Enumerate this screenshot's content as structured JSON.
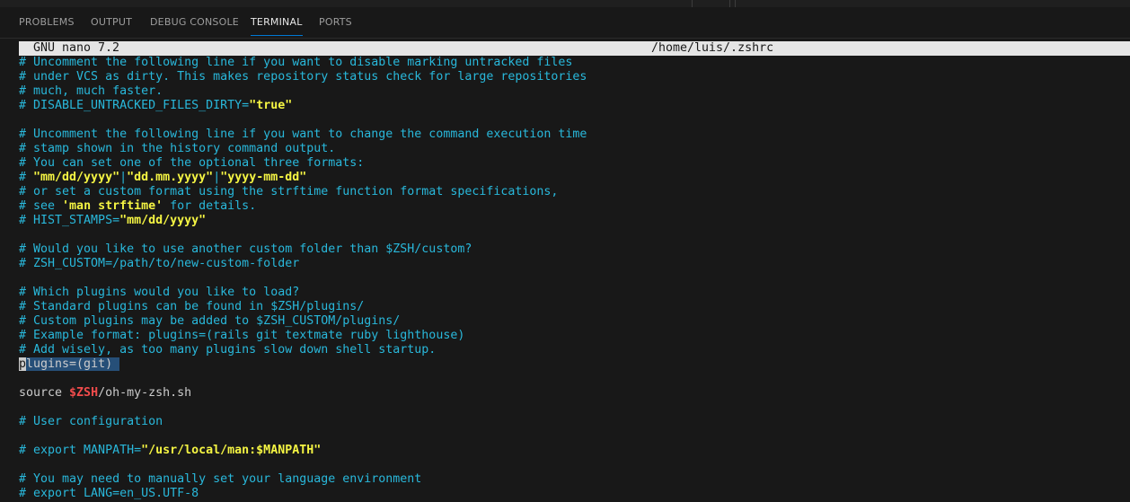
{
  "panel": {
    "tabs": [
      {
        "label": "PROBLEMS"
      },
      {
        "label": "OUTPUT"
      },
      {
        "label": "DEBUG CONSOLE"
      },
      {
        "label": "TERMINAL"
      },
      {
        "label": "PORTS"
      }
    ],
    "active_tab": "TERMINAL"
  },
  "nano": {
    "program": "GNU nano 7.2",
    "file_path": "/home/luis/.zshrc"
  },
  "editor": {
    "lines": [
      {
        "segments": [
          {
            "t": "# Uncomment the following line if you want to disable marking untracked files",
            "k": "c"
          }
        ]
      },
      {
        "segments": [
          {
            "t": "# under VCS as dirty. This makes repository status check for large repositories",
            "k": "c"
          }
        ]
      },
      {
        "segments": [
          {
            "t": "# much, much faster.",
            "k": "c"
          }
        ]
      },
      {
        "segments": [
          {
            "t": "# DISABLE_UNTRACKED_FILES_DIRTY=",
            "k": "c"
          },
          {
            "t": "\"true\"",
            "k": "y"
          }
        ]
      },
      {
        "segments": []
      },
      {
        "segments": [
          {
            "t": "# Uncomment the following line if you want to change the command execution time",
            "k": "c"
          }
        ]
      },
      {
        "segments": [
          {
            "t": "# stamp shown in the history command output.",
            "k": "c"
          }
        ]
      },
      {
        "segments": [
          {
            "t": "# You can set one of the optional three formats:",
            "k": "c"
          }
        ]
      },
      {
        "segments": [
          {
            "t": "# ",
            "k": "c"
          },
          {
            "t": "\"mm/dd/yyyy\"",
            "k": "y"
          },
          {
            "t": "|",
            "k": "c"
          },
          {
            "t": "\"dd.mm.yyyy\"",
            "k": "y"
          },
          {
            "t": "|",
            "k": "c"
          },
          {
            "t": "\"yyyy-mm-dd\"",
            "k": "y"
          }
        ]
      },
      {
        "segments": [
          {
            "t": "# or set a custom format using the strftime function format specifications,",
            "k": "c"
          }
        ]
      },
      {
        "segments": [
          {
            "t": "# see ",
            "k": "c"
          },
          {
            "t": "'man strftime'",
            "k": "y"
          },
          {
            "t": " for details.",
            "k": "c"
          }
        ]
      },
      {
        "segments": [
          {
            "t": "# HIST_STAMPS=",
            "k": "c"
          },
          {
            "t": "\"mm/dd/yyyy\"",
            "k": "y"
          }
        ]
      },
      {
        "segments": []
      },
      {
        "segments": [
          {
            "t": "# Would you like to use another custom folder than $ZSH/custom?",
            "k": "c"
          }
        ]
      },
      {
        "segments": [
          {
            "t": "# ZSH_CUSTOM=/path/to/new-custom-folder",
            "k": "c"
          }
        ]
      },
      {
        "segments": []
      },
      {
        "segments": [
          {
            "t": "# Which plugins would you like to load?",
            "k": "c"
          }
        ]
      },
      {
        "segments": [
          {
            "t": "# Standard plugins can be found in $ZSH/plugins/",
            "k": "c"
          }
        ]
      },
      {
        "segments": [
          {
            "t": "# Custom plugins may be added to $ZSH_CUSTOM/plugins/",
            "k": "c"
          }
        ]
      },
      {
        "segments": [
          {
            "t": "# Example format: plugins=(rails git textmate ruby lighthouse)",
            "k": "c"
          }
        ]
      },
      {
        "segments": [
          {
            "t": "# Add wisely, as too many plugins slow down shell startup.",
            "k": "c"
          }
        ]
      },
      {
        "segments": [
          {
            "t": "p",
            "k": "cursor"
          },
          {
            "t": "lugins=(git) ",
            "k": "hl"
          }
        ]
      },
      {
        "segments": []
      },
      {
        "segments": [
          {
            "t": "source ",
            "k": "w"
          },
          {
            "t": "$ZSH",
            "k": "r"
          },
          {
            "t": "/oh-my-zsh.sh",
            "k": "w"
          }
        ]
      },
      {
        "segments": []
      },
      {
        "segments": [
          {
            "t": "# User configuration",
            "k": "c"
          }
        ]
      },
      {
        "segments": []
      },
      {
        "segments": [
          {
            "t": "# export MANPATH=",
            "k": "c"
          },
          {
            "t": "\"/usr/local/man:$MANPATH\"",
            "k": "y"
          }
        ]
      },
      {
        "segments": []
      },
      {
        "segments": [
          {
            "t": "# You may need to manually set your language environment",
            "k": "c"
          }
        ]
      },
      {
        "segments": [
          {
            "t": "# export LANG=en_US.UTF-8",
            "k": "c"
          }
        ]
      }
    ]
  },
  "colors": {
    "background": "#181818",
    "comment": "#29b8db",
    "string": "#f5f543",
    "variable": "#f14c4c",
    "text": "#cccccc",
    "tab_active_underline": "#0078d4"
  }
}
